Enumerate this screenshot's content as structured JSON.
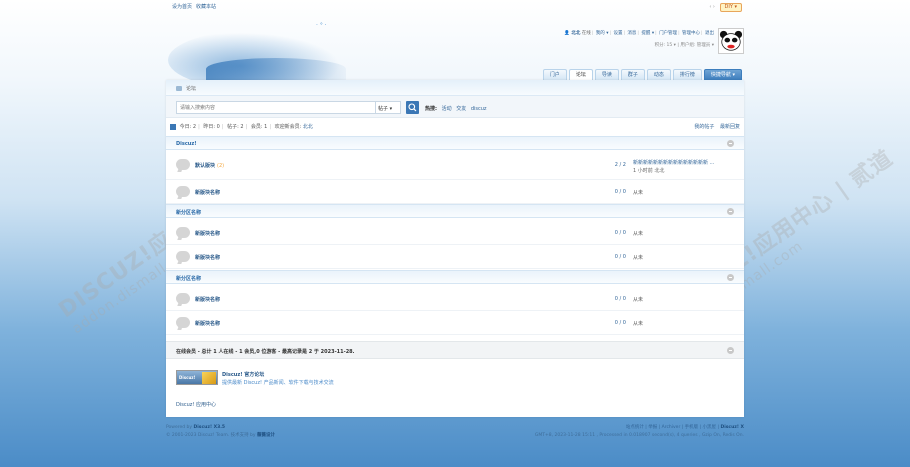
{
  "topbar": {
    "set_home": "设为首页",
    "bookmark": "收藏本站",
    "arrows": "‹ ›",
    "diy": "DIY ▾"
  },
  "user": {
    "name": "北北",
    "status": "在线",
    "my": "我的 ▾",
    "settings": "设置",
    "messages": "消息",
    "reminders": "提醒 ▾",
    "portal_admin": "门户管理",
    "admin_center": "管理中心",
    "logout": "退出",
    "credits": "积分: 15 ▾",
    "group": "用户组: 管理员 ▾"
  },
  "nav": {
    "tabs": [
      "门户",
      "论坛",
      "导读",
      "群子",
      "动态",
      "排行榜"
    ],
    "active": "论坛",
    "quick": "快捷导航 ▾"
  },
  "breadcrumb": "论坛",
  "search": {
    "placeholder": "请输入搜索内容",
    "type": "帖子 ▾",
    "hot_label": "热搜:",
    "hot": [
      "活动",
      "交友",
      "discuz"
    ]
  },
  "stats": {
    "today": "今日: 2",
    "yesterday": "昨日: 0",
    "posts": "帖子: 2",
    "members": "会员: 1",
    "welcome_prefix": "欢迎新会员:",
    "newest": "北北",
    "my_posts": "我的帖子",
    "latest_reply": "最新回复"
  },
  "categories": [
    {
      "name": "Discuz!"
    },
    {
      "name": "新分区名称"
    },
    {
      "name": "新分区名称"
    }
  ],
  "forums": [
    {
      "name": "默认版块",
      "new": "(2)",
      "count": "2 / 2",
      "last_title": "新新新新新新新新新新新新新新新 ...",
      "last_meta": "1 小时前 北北"
    },
    {
      "name": "新版块名称",
      "count": "0 / 0",
      "last": "从未"
    },
    {
      "name": "新版块名称",
      "count": "0 / 0",
      "last": "从未"
    },
    {
      "name": "新版块名称",
      "count": "0 / 0",
      "last": "从未"
    },
    {
      "name": "新版块名称",
      "count": "0 / 0",
      "last": "从未"
    },
    {
      "name": "新版块名称",
      "count": "0 / 0",
      "last": "从未"
    }
  ],
  "online": "在线会员 - 总计 1 人在线 - 1 会员,0 位游客 - 最高记录是 2 于 2023-11-28.",
  "links": {
    "logo_text": "Discuz!",
    "title": "Discuz! 官方论坛",
    "desc": "提供最新 Discuz! 产品新闻、软件下载与技术交流",
    "app": "Discuz! 应用中心"
  },
  "footer": {
    "powered": "Powered by",
    "powered_brand": "Discuz! X3.5",
    "copyright": "© 2001-2023 Discuz! Team. 技术支持 by",
    "copyright_brand": "薇薇设计",
    "links": "站点统计 | 举报 | Archiver | 手机版 | 小黑屋 |",
    "links_brand": "Discuz! X",
    "gmt": "GMT+8, 2023-11-28 15:11 , Processed in 0.018907 second(s), 4 queries , Gzip On, Redis On."
  },
  "watermark": {
    "main": "DISCUZ!应用中心 | 贰道",
    "sub": "addon.dismall.com"
  },
  "colors": {
    "accent": "#336699",
    "button": "#3b77b5",
    "diy_border": "#e8a65b"
  }
}
